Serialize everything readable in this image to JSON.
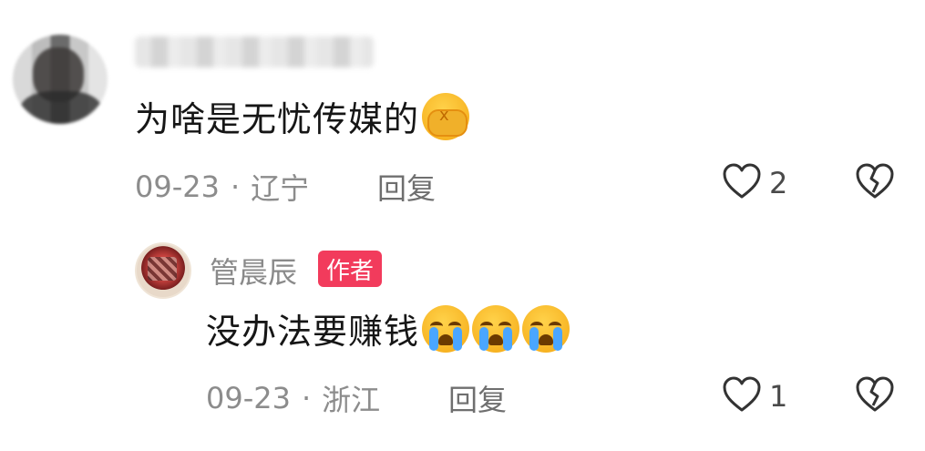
{
  "comments": [
    {
      "text": "为啥是无忧传媒的",
      "emoji": "facepalm-emoji",
      "date": "09-23",
      "separator": "·",
      "location": "辽宁",
      "reply_label": "回复",
      "like_count": "2"
    }
  ],
  "reply": {
    "author": "管晨辰",
    "badge": "作者",
    "text": "没办法要赚钱",
    "emojis": [
      "crying-emoji",
      "crying-emoji",
      "crying-emoji"
    ],
    "date": "09-23",
    "separator": "·",
    "location": "浙江",
    "reply_label": "回复",
    "like_count": "1"
  },
  "colors": {
    "badge": "#f23b5c",
    "meta_text": "#8c8c8c",
    "icon": "#333333"
  }
}
